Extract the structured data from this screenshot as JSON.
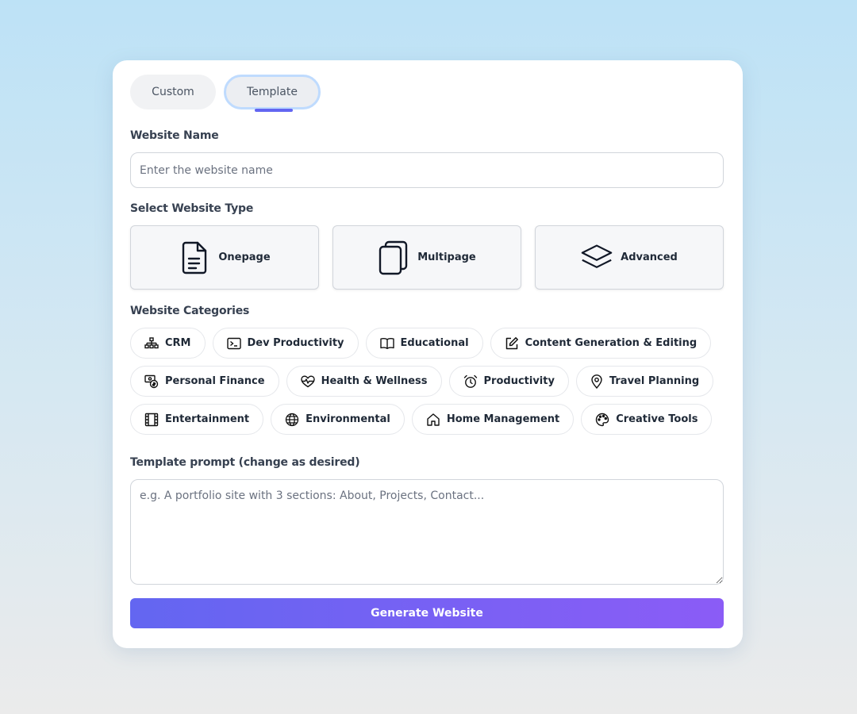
{
  "tabs": {
    "custom": "Custom",
    "template": "Template"
  },
  "form": {
    "website_name_label": "Website Name",
    "website_name_placeholder": "Enter the website name",
    "website_name_value": "",
    "website_type_label": "Select Website Type",
    "website_types": [
      {
        "label": "Onepage",
        "icon": "document-icon"
      },
      {
        "label": "Multipage",
        "icon": "copy-pages-icon"
      },
      {
        "label": "Advanced",
        "icon": "layers-icon"
      }
    ],
    "categories_label": "Website Categories",
    "categories": [
      {
        "label": "CRM",
        "icon": "org-chart-icon"
      },
      {
        "label": "Dev Productivity",
        "icon": "terminal-icon"
      },
      {
        "label": "Educational",
        "icon": "book-icon"
      },
      {
        "label": "Content Generation & Editing",
        "icon": "edit-icon"
      },
      {
        "label": "Personal Finance",
        "icon": "finance-icon"
      },
      {
        "label": "Health & Wellness",
        "icon": "heart-pulse-icon"
      },
      {
        "label": "Productivity",
        "icon": "alarm-clock-icon"
      },
      {
        "label": "Travel Planning",
        "icon": "map-pin-icon"
      },
      {
        "label": "Entertainment",
        "icon": "film-icon"
      },
      {
        "label": "Environmental",
        "icon": "globe-icon"
      },
      {
        "label": "Home Management",
        "icon": "home-icon"
      },
      {
        "label": "Creative Tools",
        "icon": "palette-icon"
      }
    ],
    "prompt_label": "Template prompt (change as desired)",
    "prompt_placeholder": "e.g. A portfolio site with 3 sections: About, Projects, Contact...",
    "prompt_value": "",
    "generate_label": "Generate Website"
  },
  "colors": {
    "accent": "#6366f1",
    "gradient_end": "#8b5cf6",
    "tab_focus_ring": "#bfdbfe"
  }
}
